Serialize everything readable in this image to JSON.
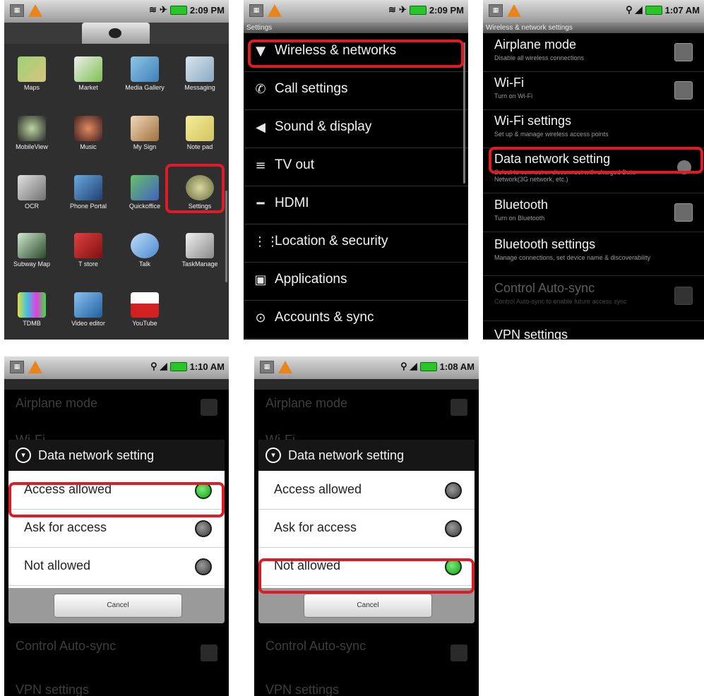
{
  "panel1": {
    "time": "2:09 PM",
    "apps": [
      {
        "label": "Maps"
      },
      {
        "label": "Market"
      },
      {
        "label": "Media Gallery"
      },
      {
        "label": "Messaging"
      },
      {
        "label": "MobileView"
      },
      {
        "label": "Music"
      },
      {
        "label": "My Sign"
      },
      {
        "label": "Note pad"
      },
      {
        "label": "OCR"
      },
      {
        "label": "Phone Portal"
      },
      {
        "label": "Quickoffice"
      },
      {
        "label": "Settings"
      },
      {
        "label": "Subway Map"
      },
      {
        "label": "T store"
      },
      {
        "label": "Talk"
      },
      {
        "label": "TaskManage"
      },
      {
        "label": "TDMB"
      },
      {
        "label": "Video editor"
      },
      {
        "label": "YouTube"
      }
    ]
  },
  "panel2": {
    "time": "2:09 PM",
    "title": "Settings",
    "items": [
      {
        "label": "Wireless & networks",
        "icon": "wifi-icon"
      },
      {
        "label": "Call settings",
        "icon": "phone-icon"
      },
      {
        "label": "Sound & display",
        "icon": "speaker-icon"
      },
      {
        "label": "TV out",
        "icon": "tv-out-icon"
      },
      {
        "label": "HDMI",
        "icon": "hdmi-icon"
      },
      {
        "label": "Location & security",
        "icon": "grid-icon"
      },
      {
        "label": "Applications",
        "icon": "applications-icon"
      },
      {
        "label": "Accounts & sync",
        "icon": "sync-icon"
      }
    ]
  },
  "panel3": {
    "time": "1:07 AM",
    "title": "Wireless & network settings",
    "prefs": [
      {
        "title": "Airplane mode",
        "sub": "Disable all wireless connections"
      },
      {
        "title": "Wi-Fi",
        "sub": "Turn on Wi-Fi"
      },
      {
        "title": "Wi-Fi settings",
        "sub": "Set up & manage wireless access points"
      },
      {
        "title": "Data network setting",
        "sub": "Select to connect or disconnect with charged Data Network(3G network, etc.)"
      },
      {
        "title": "Bluetooth",
        "sub": "Turn on Bluetooth"
      },
      {
        "title": "Bluetooth settings",
        "sub": "Manage connections, set device name & discoverability"
      },
      {
        "title": "Control Auto-sync",
        "sub": "Control Auto-sync to enable future access sync"
      },
      {
        "title": "VPN settings",
        "sub": ""
      }
    ]
  },
  "dialog": {
    "title": "Data network setting",
    "options": [
      "Access allowed",
      "Ask for access",
      "Not allowed"
    ],
    "cancel": "Cancel"
  },
  "panel4": {
    "time": "1:10 AM",
    "selected": "Access allowed"
  },
  "panel5": {
    "time": "1:08 AM",
    "selected": "Not allowed"
  },
  "background": {
    "airplane": "Airplane mode",
    "wifi": "Wi-Fi",
    "autosync": "Control Auto-sync",
    "vpn": "VPN settings"
  },
  "colors": {
    "highlight": "#e01b24",
    "radio_on": "#10a010"
  }
}
